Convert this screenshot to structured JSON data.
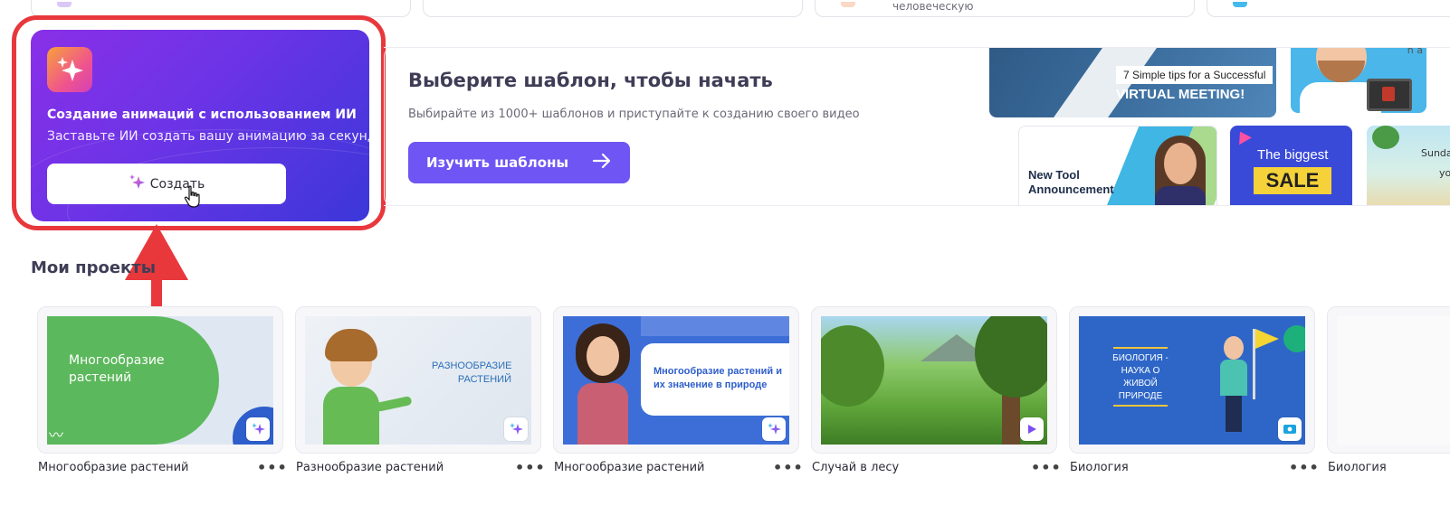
{
  "top_cards": [
    {
      "text": ""
    },
    {
      "text": ""
    },
    {
      "text": "человеческую"
    },
    {
      "text": ""
    }
  ],
  "ai_card": {
    "title": "Создание анимаций с использованием ИИ",
    "subtitle": "Заставьте ИИ создать вашу анимацию за секунду",
    "create_label": "Создать",
    "icon": "sparkles-icon",
    "highlight_color": "#e8383c"
  },
  "templates": {
    "title": "Выберите шаблон, чтобы начать",
    "subtitle": "Выбирайте из 1000+ шаблонов и приступайте к созданию своего видео",
    "button_label": "Изучить шаблоны",
    "button_icon": "arrow-right-icon",
    "accent": "#6f55f3",
    "thumbs": {
      "meeting_tag": "7 Simple tips for a Successful",
      "meeting_title": "VIRTUAL MEETING!",
      "announcement": "New Tool Announcement",
      "sale_top": "The biggest",
      "sale_word": "SALE",
      "sunday_line1": "Sunda",
      "sunday_line2": "yo",
      "tiny_corner": "n a"
    }
  },
  "projects": {
    "section_title": "Мои проекты",
    "items": [
      {
        "name": "Многообразие растений",
        "thumb_text": "Многообразие растений",
        "badge": "ai-sparkle-icon"
      },
      {
        "name": "Разнообразие растений",
        "thumb_text": "РАЗНООБРАЗИЕ РАСТЕНИЙ",
        "badge": "ai-sparkle-icon"
      },
      {
        "name": "Многообразие растений",
        "thumb_text": "Многообразие растений и их значение в природе",
        "badge": "ai-sparkle-icon"
      },
      {
        "name": "Случай в лесу",
        "thumb_text": "",
        "badge": "video-icon"
      },
      {
        "name": "Биология",
        "thumb_text": "БИОЛОГИЯ - НАУКА О ЖИВОЙ ПРИРОДЕ",
        "badge": "presentation-icon"
      },
      {
        "name": "Биология",
        "thumb_text": "",
        "badge": ""
      }
    ],
    "menu_label": "•••"
  }
}
